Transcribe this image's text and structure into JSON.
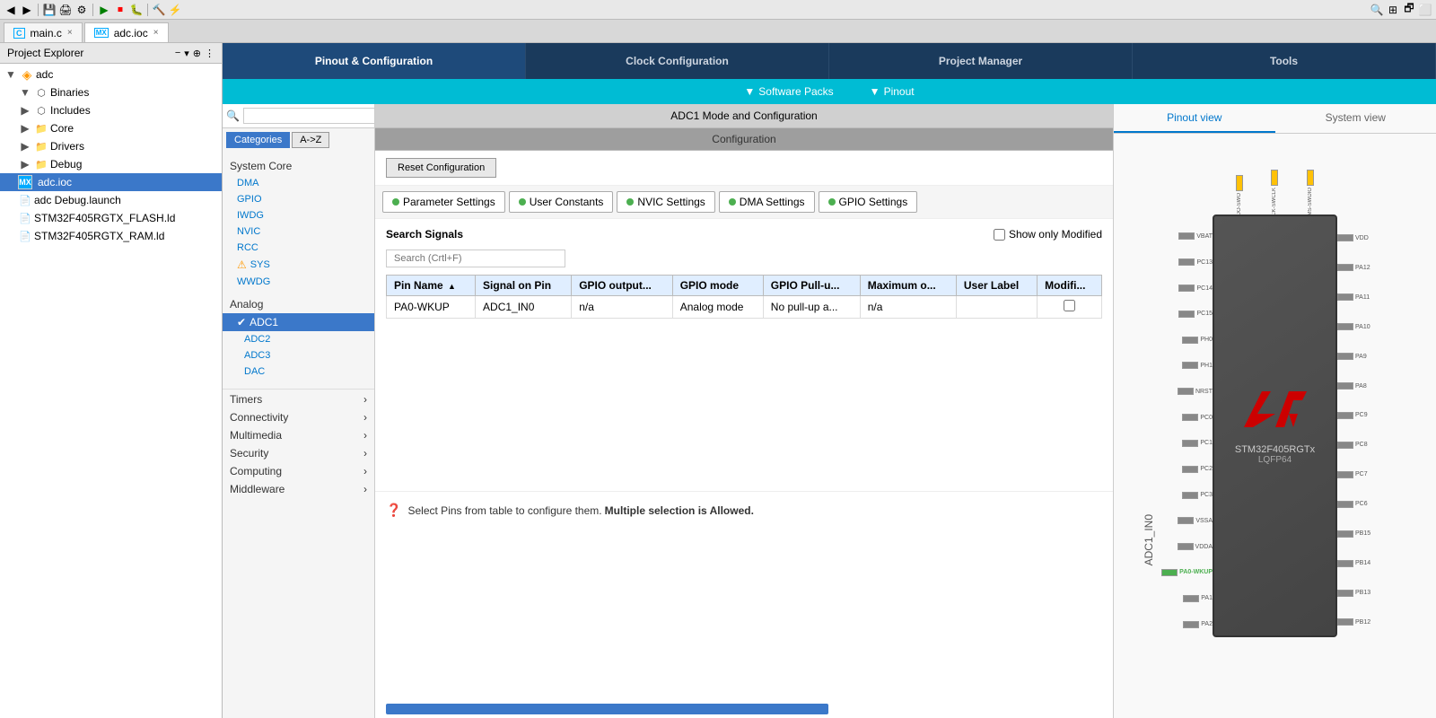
{
  "toolbar": {
    "icons": [
      "◀",
      "▶",
      "⚙",
      "▶",
      "⏹",
      "🐞",
      "▶",
      "⏸",
      "⏹",
      "🔨",
      "⚡",
      "🔍"
    ]
  },
  "tabs": [
    {
      "label": "main.c",
      "icon": "C",
      "active": false,
      "closeable": true
    },
    {
      "label": "adc.ioc",
      "icon": "MX",
      "active": true,
      "closeable": true
    }
  ],
  "project_explorer": {
    "title": "Project Explorer",
    "items": [
      {
        "label": "adc",
        "level": 0,
        "icon": "project",
        "expanded": true
      },
      {
        "label": "Binaries",
        "level": 1,
        "icon": "bin",
        "expanded": true
      },
      {
        "label": "Includes",
        "level": 1,
        "icon": "inc",
        "expanded": false
      },
      {
        "label": "Core",
        "level": 1,
        "icon": "folder",
        "expanded": false
      },
      {
        "label": "Drivers",
        "level": 1,
        "icon": "folder",
        "expanded": false
      },
      {
        "label": "Debug",
        "level": 1,
        "icon": "folder",
        "expanded": false
      },
      {
        "label": "adc.ioc",
        "level": 1,
        "icon": "mx",
        "selected": true
      },
      {
        "label": "adc Debug.launch",
        "level": 1,
        "icon": "launch"
      },
      {
        "label": "STM32F405RGTX_FLASH.ld",
        "level": 1,
        "icon": "ld"
      },
      {
        "label": "STM32F405RGTX_RAM.ld",
        "level": 1,
        "icon": "ld"
      }
    ]
  },
  "nav": {
    "tabs": [
      {
        "label": "Pinout & Configuration",
        "active": true
      },
      {
        "label": "Clock Configuration",
        "active": false
      },
      {
        "label": "Project Manager",
        "active": false
      },
      {
        "label": "Tools",
        "active": false
      }
    ],
    "sub_items": [
      {
        "label": "Software Packs",
        "icon": "▼"
      },
      {
        "label": "Pinout",
        "icon": "▼"
      }
    ]
  },
  "categories": {
    "search_placeholder": "",
    "buttons": [
      {
        "label": "Categories",
        "active": true
      },
      {
        "label": "A->Z",
        "active": false
      }
    ],
    "system_core": {
      "label": "System Core",
      "items": [
        "DMA",
        "GPIO",
        "IWDG",
        "NVIC",
        "RCC",
        "SYS",
        "WWDG"
      ]
    },
    "analog": {
      "label": "Analog",
      "items": [
        {
          "label": "ADC1",
          "selected": true
        },
        {
          "label": "ADC2"
        },
        {
          "label": "ADC3"
        },
        {
          "label": "DAC"
        }
      ]
    },
    "groups": [
      {
        "label": "Timers",
        "expanded": false
      },
      {
        "label": "Connectivity",
        "expanded": false
      },
      {
        "label": "Multimedia",
        "expanded": false
      },
      {
        "label": "Security",
        "expanded": false
      },
      {
        "label": "Computing",
        "expanded": false
      },
      {
        "label": "Middleware",
        "expanded": false
      }
    ]
  },
  "config": {
    "mode_title": "ADC1 Mode and Configuration",
    "config_title": "Configuration",
    "reset_btn": "Reset Configuration",
    "tabs": [
      {
        "label": "Parameter Settings",
        "dot": true
      },
      {
        "label": "User Constants",
        "dot": true
      },
      {
        "label": "NVIC Settings",
        "dot": true
      },
      {
        "label": "DMA Settings",
        "dot": true
      },
      {
        "label": "GPIO Settings",
        "dot": true
      }
    ],
    "gpio_tab": {
      "search_label": "Search Signals",
      "search_placeholder": "Search (Crtl+F)",
      "show_modified_label": "Show only Modified",
      "columns": [
        {
          "label": "Pin Name",
          "sorted": true
        },
        {
          "label": "Signal on Pin"
        },
        {
          "label": "GPIO output..."
        },
        {
          "label": "GPIO mode"
        },
        {
          "label": "GPIO Pull-u..."
        },
        {
          "label": "Maximum o..."
        },
        {
          "label": "User Label"
        },
        {
          "label": "Modifi..."
        }
      ],
      "rows": [
        {
          "pin_name": "PA0-WKUP",
          "signal": "ADC1_IN0",
          "gpio_output": "n/a",
          "gpio_mode": "Analog mode",
          "gpio_pull": "No pull-up a...",
          "max_output": "n/a",
          "user_label": "",
          "modified": false
        }
      ],
      "hint": "Select Pins from table to configure them.",
      "hint_bold": "Multiple selection is Allowed."
    }
  },
  "chip_view": {
    "tabs": [
      "Pinout view",
      "System view"
    ],
    "active_tab": "Pinout view",
    "chip_name": "STM32F405RGTx",
    "chip_package": "LQFP64",
    "chip_logo": "ST",
    "left_pins": [
      {
        "label": "VBAT",
        "color": "gray"
      },
      {
        "label": "PC13",
        "color": "gray"
      },
      {
        "label": "PC14",
        "color": "gray"
      },
      {
        "label": "PC15",
        "color": "gray"
      },
      {
        "label": "PH0",
        "color": "gray"
      },
      {
        "label": "PH1",
        "color": "gray"
      },
      {
        "label": "NRST",
        "color": "gray"
      },
      {
        "label": "PC0",
        "color": "gray"
      },
      {
        "label": "PC1",
        "color": "gray"
      },
      {
        "label": "PC2",
        "color": "gray"
      },
      {
        "label": "PC3",
        "color": "gray"
      },
      {
        "label": "VSSA",
        "color": "gray"
      },
      {
        "label": "VDDA",
        "color": "gray"
      },
      {
        "label": "PA0",
        "color": "green"
      },
      {
        "label": "PA1",
        "color": "gray"
      },
      {
        "label": "PA2",
        "color": "gray"
      }
    ],
    "right_pins": [
      {
        "label": "VDD",
        "color": "gray"
      },
      {
        "label": "PA12",
        "color": "gray"
      },
      {
        "label": "PA11",
        "color": "gray"
      },
      {
        "label": "PA10",
        "color": "gray"
      },
      {
        "label": "PA9",
        "color": "gray"
      },
      {
        "label": "PA8",
        "color": "gray"
      },
      {
        "label": "PC9",
        "color": "gray"
      },
      {
        "label": "PC8",
        "color": "gray"
      },
      {
        "label": "PC7",
        "color": "gray"
      },
      {
        "label": "PC6",
        "color": "gray"
      },
      {
        "label": "PB15",
        "color": "gray"
      },
      {
        "label": "PB14",
        "color": "gray"
      },
      {
        "label": "PB13",
        "color": "gray"
      },
      {
        "label": "PB12",
        "color": "gray"
      }
    ],
    "top_pins": [
      {
        "label": "SYS_JTDO-SWO",
        "color": "yellow"
      },
      {
        "label": "SYS_JTCK-SWCLK",
        "color": "yellow"
      }
    ],
    "bottom_label": "ADC1_IN0"
  }
}
